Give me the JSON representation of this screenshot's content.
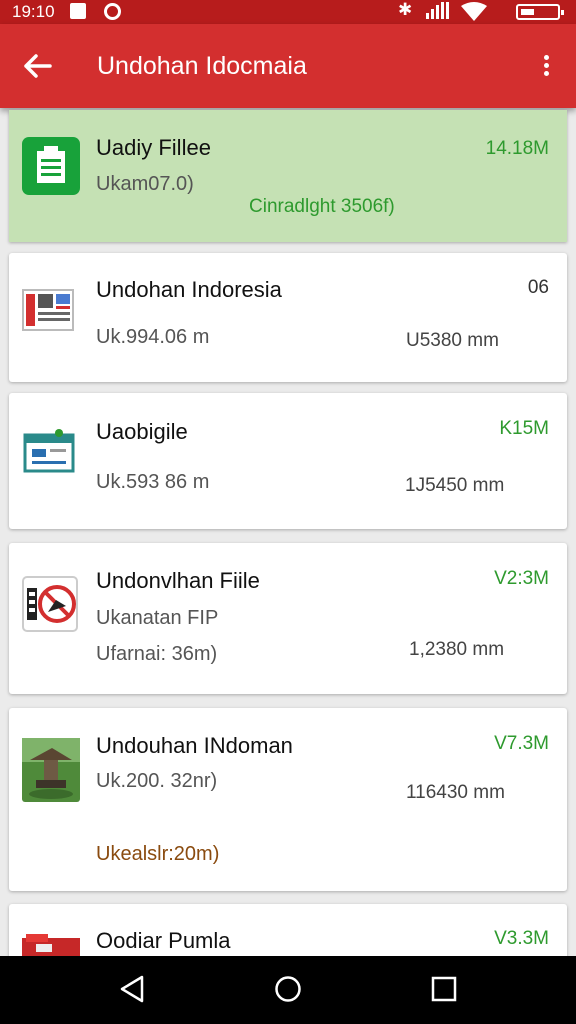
{
  "status_bar": {
    "time": "19:10",
    "bluetooth_glyph": "✱"
  },
  "app_bar": {
    "title": "Undohan Idocmaia",
    "back_icon": "arrow-left-icon",
    "menu_icon": "more-vert-icon"
  },
  "items": [
    {
      "name": "Uadiy Fillee",
      "line1": "Ukam07.0)",
      "line2": "Cinradlght 3506f)",
      "size": "14.18M",
      "icon": "clipboard-icon",
      "highlighted": true
    },
    {
      "name": "Undohan Indoresia",
      "line1": "Uk.994.06 m",
      "mid": "U5380 mm",
      "size": "06",
      "icon": "newspaper-icon"
    },
    {
      "name": "Uaobigile",
      "line1": "Uk.593 86 m",
      "mid": "1J5450 mm",
      "size": "K15M",
      "icon": "document-card-icon"
    },
    {
      "name": "Undonvlhan Fiile",
      "line1": "Ukanatan FIP",
      "line2": "Ufarnai: 36m)",
      "mid": "1,2380 mm",
      "size": "V2:3M",
      "icon": "no-photo-icon"
    },
    {
      "name": "Undouhan INdoman",
      "line1": "Uk.200. 32nr)",
      "line2": "Ukealslr:20m)",
      "mid": "116430 mm",
      "size": "V7.3M",
      "icon": "landscape-thumbnail-icon"
    },
    {
      "name": "Oodiar Pumla",
      "size": "V3.3M",
      "icon": "folder-red-icon"
    }
  ],
  "nav_bar": {
    "back": "nav-back-icon",
    "home": "nav-home-icon",
    "recents": "nav-recents-icon"
  },
  "colors": {
    "app_bar": "#d32f2f",
    "status_bar": "#b71c1c",
    "highlight": "#c5e1b4",
    "accent_green": "#2e9a2e"
  }
}
